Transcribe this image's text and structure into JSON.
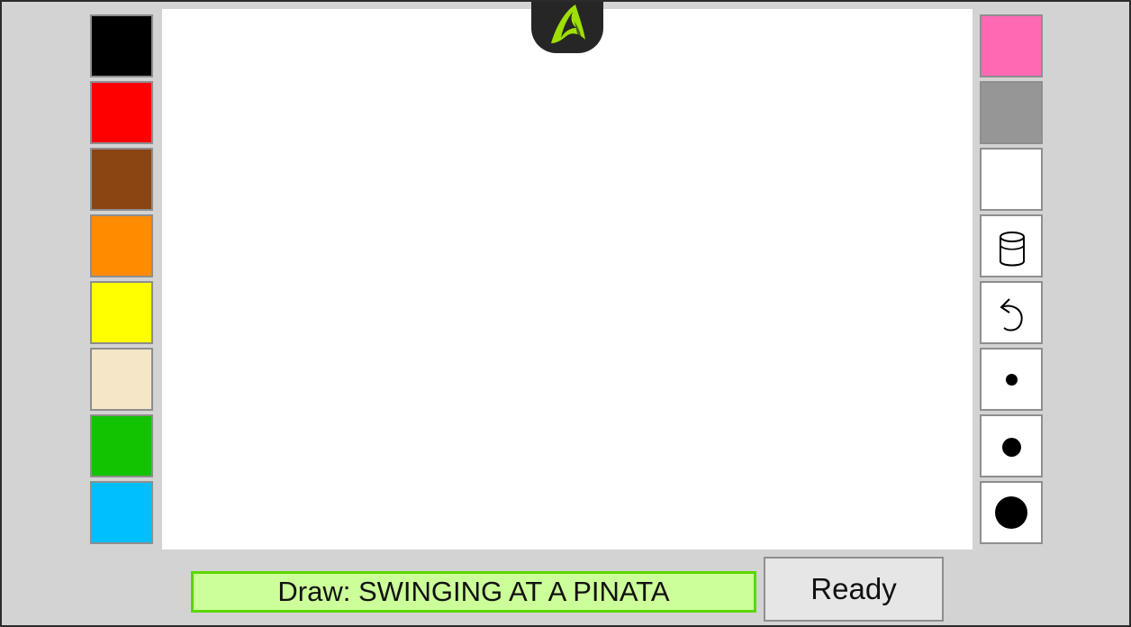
{
  "prompt": {
    "prefix": "Draw: ",
    "word": "SWINGING AT A PINATA",
    "text": "Draw: SWINGING AT A PINATA"
  },
  "ready_button": {
    "label": "Ready"
  },
  "palette_left": [
    {
      "name": "black",
      "color": "#000000"
    },
    {
      "name": "red",
      "color": "#ff0000"
    },
    {
      "name": "brown",
      "color": "#8b4513"
    },
    {
      "name": "orange",
      "color": "#ff8c00"
    },
    {
      "name": "yellow",
      "color": "#ffff00"
    },
    {
      "name": "beige",
      "color": "#f5e6c8"
    },
    {
      "name": "green",
      "color": "#11c300"
    },
    {
      "name": "light-blue",
      "color": "#00bfff"
    }
  ],
  "palette_right": [
    {
      "name": "pink",
      "color": "#ff69b4"
    },
    {
      "name": "gray",
      "color": "#969696"
    },
    {
      "name": "white",
      "color": "#ffffff"
    }
  ],
  "tools": [
    {
      "name": "fill-bucket",
      "icon": "bucket-icon"
    },
    {
      "name": "undo",
      "icon": "undo-icon"
    },
    {
      "name": "brush-small",
      "icon": "small-brush-dot-icon"
    },
    {
      "name": "brush-medium",
      "icon": "medium-brush-dot-icon"
    },
    {
      "name": "brush-large",
      "icon": "large-brush-dot-icon"
    }
  ],
  "colors": {
    "background": "#d3d3d3",
    "canvas": "#ffffff",
    "logo_bg": "#262626",
    "logo_accent": "#9fe000",
    "prompt_bg": "#ccff99",
    "prompt_border": "#5cd600"
  }
}
